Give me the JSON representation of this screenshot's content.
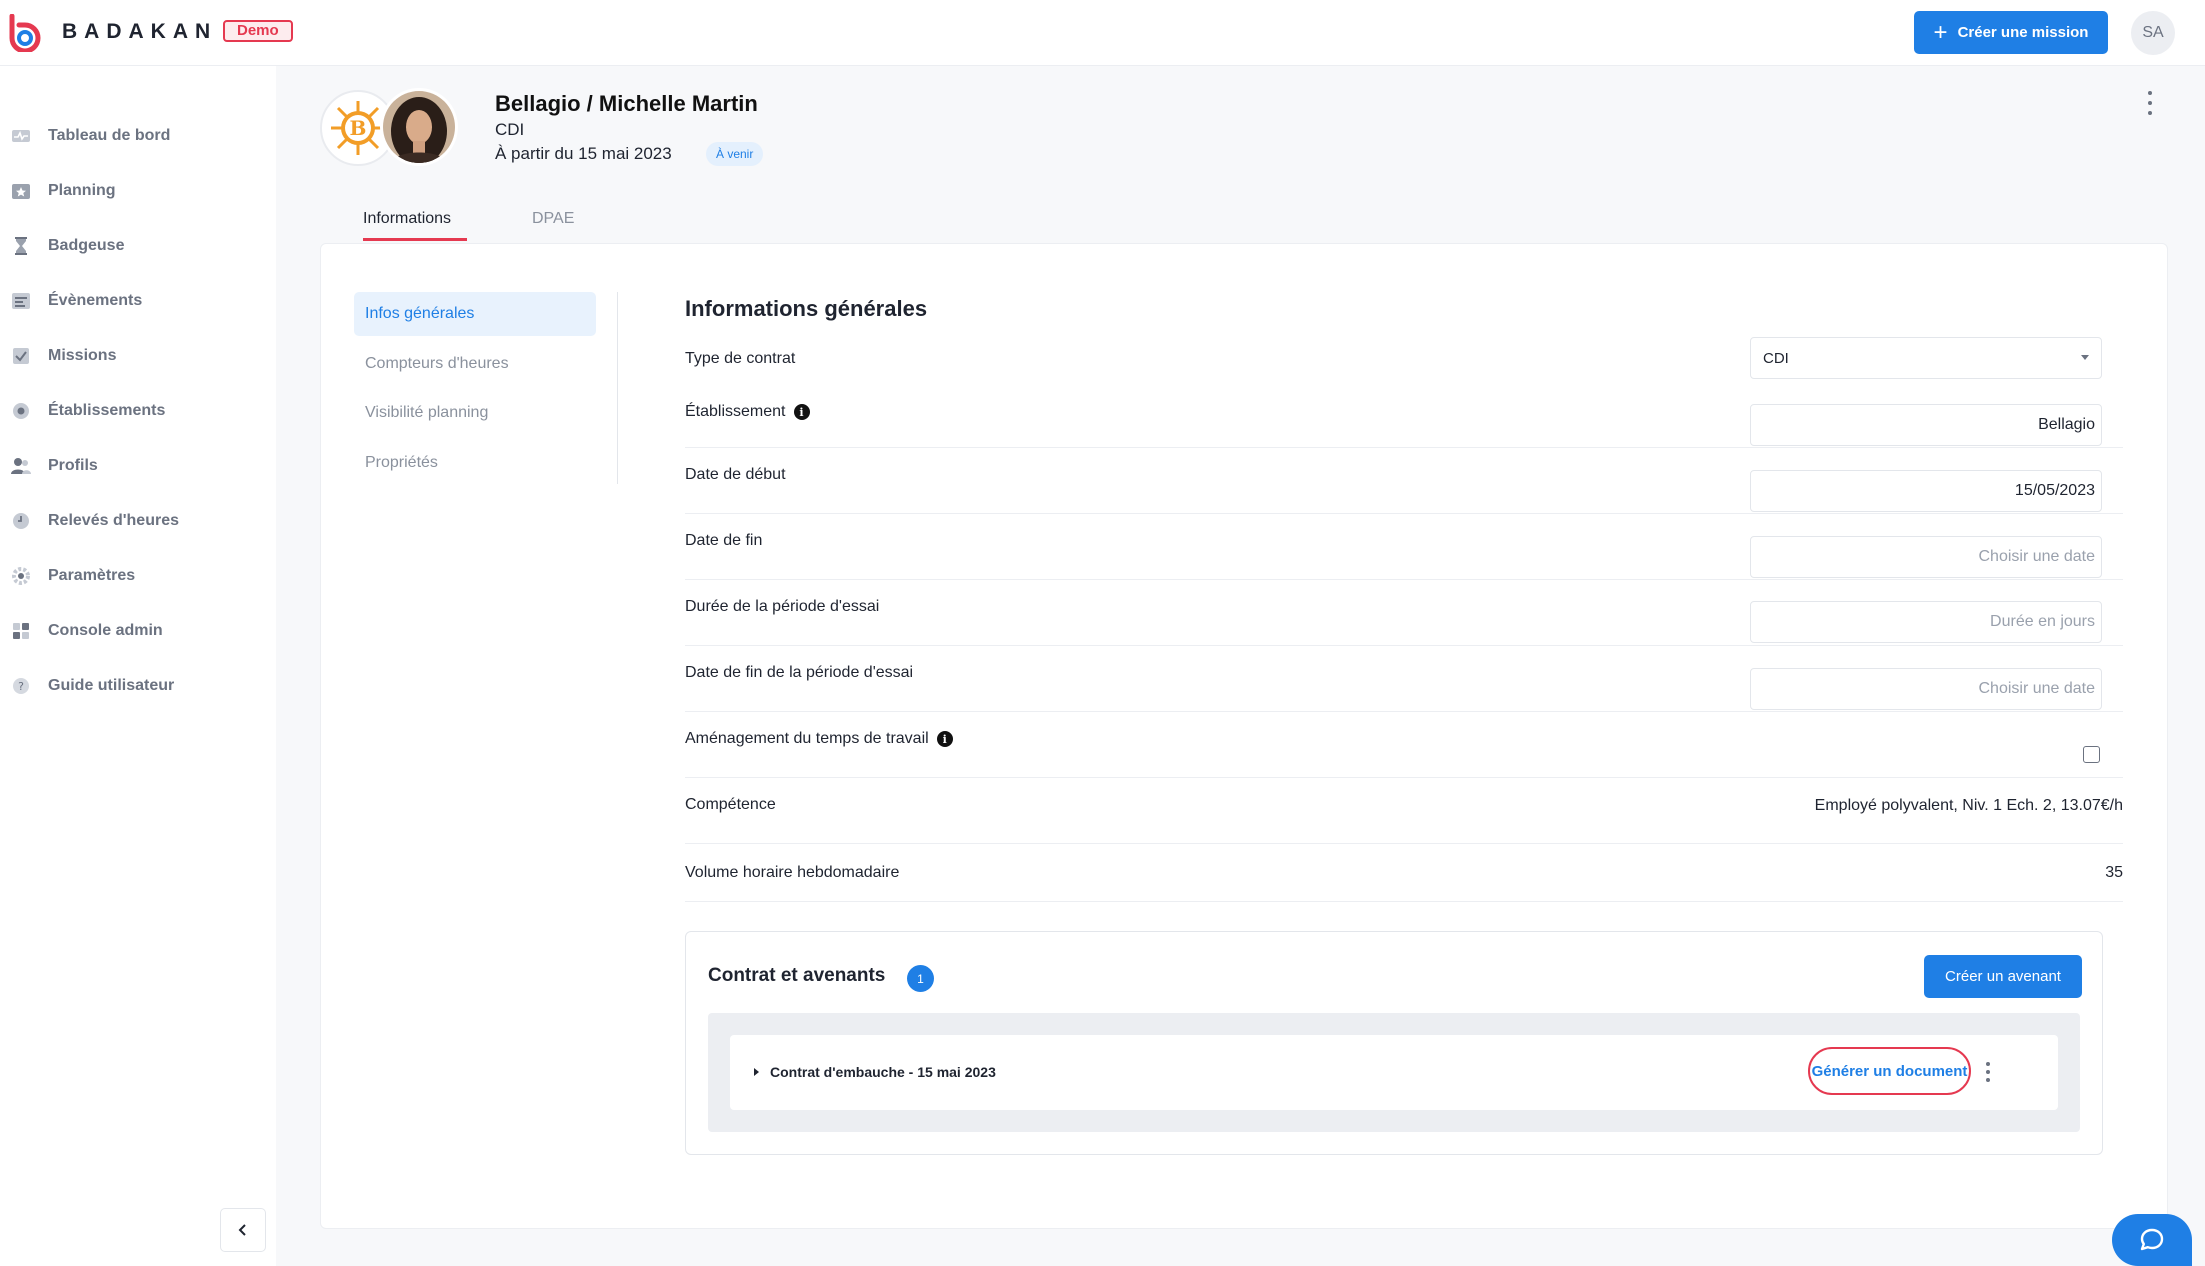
{
  "app": {
    "brand": "BADAKAN",
    "env_badge": "Demo",
    "accent_color": "#1f7fe5",
    "highlight_color": "#e53950"
  },
  "header": {
    "create_mission_label": "Créer une mission",
    "user_initials": "SA"
  },
  "sidebar": {
    "items": [
      {
        "label": "Tableau de bord",
        "icon": "dashboard-icon"
      },
      {
        "label": "Planning",
        "icon": "calendar-star-icon"
      },
      {
        "label": "Badgeuse",
        "icon": "hourglass-icon"
      },
      {
        "label": "Évènements",
        "icon": "events-list-icon"
      },
      {
        "label": "Missions",
        "icon": "checkbox-icon"
      },
      {
        "label": "Établissements",
        "icon": "building-icon"
      },
      {
        "label": "Profils",
        "icon": "users-icon"
      },
      {
        "label": "Relevés d'heures",
        "icon": "clock-icon"
      },
      {
        "label": "Paramètres",
        "icon": "gear-icon"
      },
      {
        "label": "Console admin",
        "icon": "grid-icon"
      },
      {
        "label": "Guide utilisateur",
        "icon": "help-icon"
      }
    ]
  },
  "profile": {
    "title": "Bellagio / Michelle Martin",
    "contract_type": "CDI",
    "start_text": "À partir du 15 mai 2023",
    "status": "À venir"
  },
  "tabs": [
    {
      "label": "Informations",
      "active": true
    },
    {
      "label": "DPAE",
      "active": false
    }
  ],
  "subnav": [
    {
      "label": "Infos générales",
      "active": true
    },
    {
      "label": "Compteurs d'heures",
      "active": false
    },
    {
      "label": "Visibilité planning",
      "active": false
    },
    {
      "label": "Propriétés",
      "active": false
    }
  ],
  "section": {
    "title": "Informations générales",
    "fields": {
      "contract_type": {
        "label": "Type de contrat",
        "value": "CDI"
      },
      "establishment": {
        "label": "Établissement",
        "value": "Bellagio"
      },
      "start_date": {
        "label": "Date de début",
        "value": "15/05/2023"
      },
      "end_date": {
        "label": "Date de fin",
        "placeholder": "Choisir une date"
      },
      "trial_duration": {
        "label": "Durée de la période d'essai",
        "placeholder": "Durée en jours"
      },
      "trial_end": {
        "label": "Date de fin de la période d'essai",
        "placeholder": "Choisir une date"
      },
      "work_arrangement": {
        "label": "Aménagement du temps de travail",
        "checked": false
      },
      "skill": {
        "label": "Compétence",
        "value": "Employé polyvalent, Niv. 1 Ech. 2, 13.07€/h"
      },
      "weekly_hours": {
        "label": "Volume horaire hebdomadaire",
        "value": "35"
      }
    }
  },
  "contracts": {
    "title": "Contrat et avenants",
    "count": "1",
    "create_label": "Créer un avenant",
    "items": [
      {
        "label": "Contrat d'embauche - 15 mai 2023",
        "action_label": "Générer un document"
      }
    ]
  }
}
